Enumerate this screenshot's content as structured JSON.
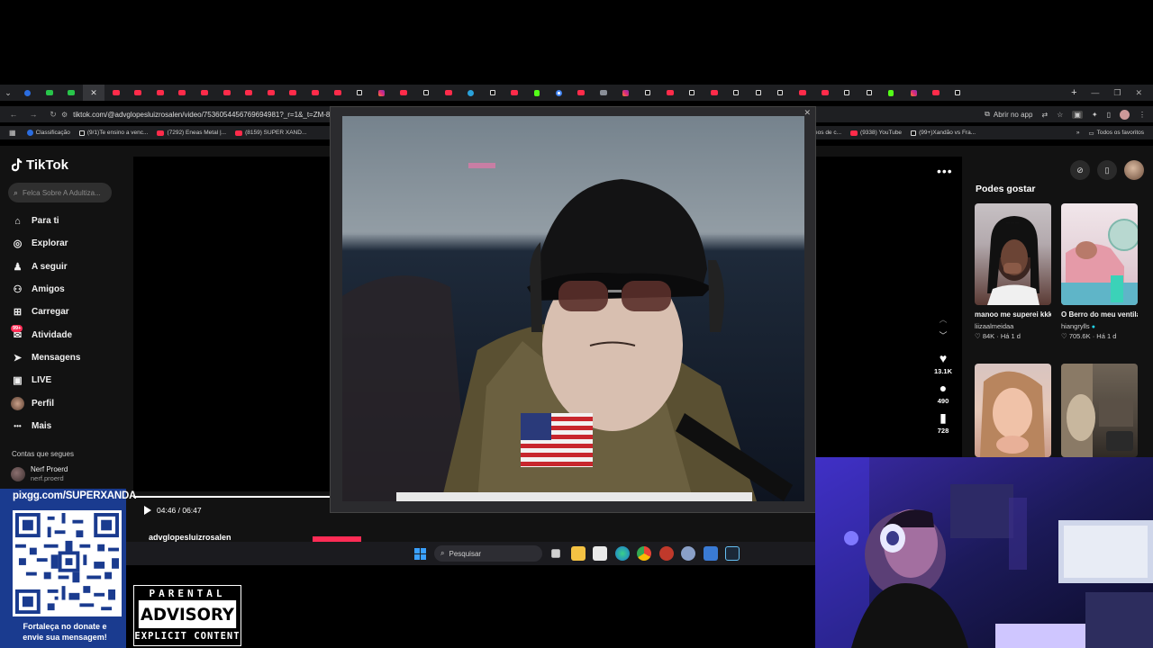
{
  "browser": {
    "tabs_count": 45,
    "new_tab_label": "+",
    "url": "tiktok.com/@advglopesluizrosalen/video/7536054456769694981?_r=1&_t=ZM-8",
    "open_app_label": "Abrir no app",
    "bookmarks": [
      {
        "label": "Classificação",
        "icon": "blue"
      },
      {
        "label": "(9/1)Te ensino a venc...",
        "icon": "tt"
      },
      {
        "label": "(7292) Eneas Metal |...",
        "icon": "yt"
      },
      {
        "label": "(8159) SUPER XAND...",
        "icon": "yt"
      },
      {
        "label": "vídeos de c...",
        "icon": "none"
      },
      {
        "label": "(9338) YouTube",
        "icon": "yt"
      },
      {
        "label": "(99+)Xandão vs Fra...",
        "icon": "tt"
      }
    ],
    "all_favorites_label": "Todos os favoritos"
  },
  "tiktok": {
    "logo": "TikTok",
    "search_placeholder": "Felca Sobre A Adultiza...",
    "nav": [
      {
        "label": "Para ti",
        "icon": "home-icon"
      },
      {
        "label": "Explorar",
        "icon": "compass-icon"
      },
      {
        "label": "A seguir",
        "icon": "following-icon"
      },
      {
        "label": "Amigos",
        "icon": "friends-icon"
      },
      {
        "label": "Carregar",
        "icon": "upload-icon"
      },
      {
        "label": "Atividade",
        "icon": "activity-icon",
        "badge": "99+"
      },
      {
        "label": "Mensagens",
        "icon": "messages-icon"
      },
      {
        "label": "LIVE",
        "icon": "live-icon"
      },
      {
        "label": "Perfil",
        "icon": "profile-icon"
      },
      {
        "label": "Mais",
        "icon": "more-icon"
      }
    ],
    "following_title": "Contas que segues",
    "following": {
      "name": "Nerf Proerd",
      "handle": "nerf.proerd"
    },
    "video": {
      "time": "04:46 / 06:47",
      "progress_fraction": 0.7,
      "author": "advglopesluizrosalen",
      "likes": "13.1K",
      "comments": "490",
      "saves": "728"
    },
    "suggest_title": "Podes gostar",
    "suggestions": [
      {
        "title": "manoo me superei kkkkkk",
        "user": "liizaalmeidaa",
        "likes": "84K",
        "age": "Há 1 d"
      },
      {
        "title": "O Berro do meu ventilador é o som...",
        "user": "hiangrylls",
        "likes": "705.6K",
        "age": "Há 1 d"
      },
      {
        "title": "",
        "user": "",
        "likes": "",
        "age": ""
      },
      {
        "title": "",
        "user": "",
        "likes": "",
        "age": ""
      }
    ]
  },
  "taskbar": {
    "search_placeholder": "Pesquisar"
  },
  "overlay": {
    "qr_url": "pixgg.com/SUPERXANDA",
    "qr_caption_line1": "Fortaleça no donate e",
    "qr_caption_line2": "envie sua mensagem!",
    "advisory_top": "PARENTAL",
    "advisory_mid": "ADVISORY",
    "advisory_bot": "EXPLICIT CONTENT"
  }
}
